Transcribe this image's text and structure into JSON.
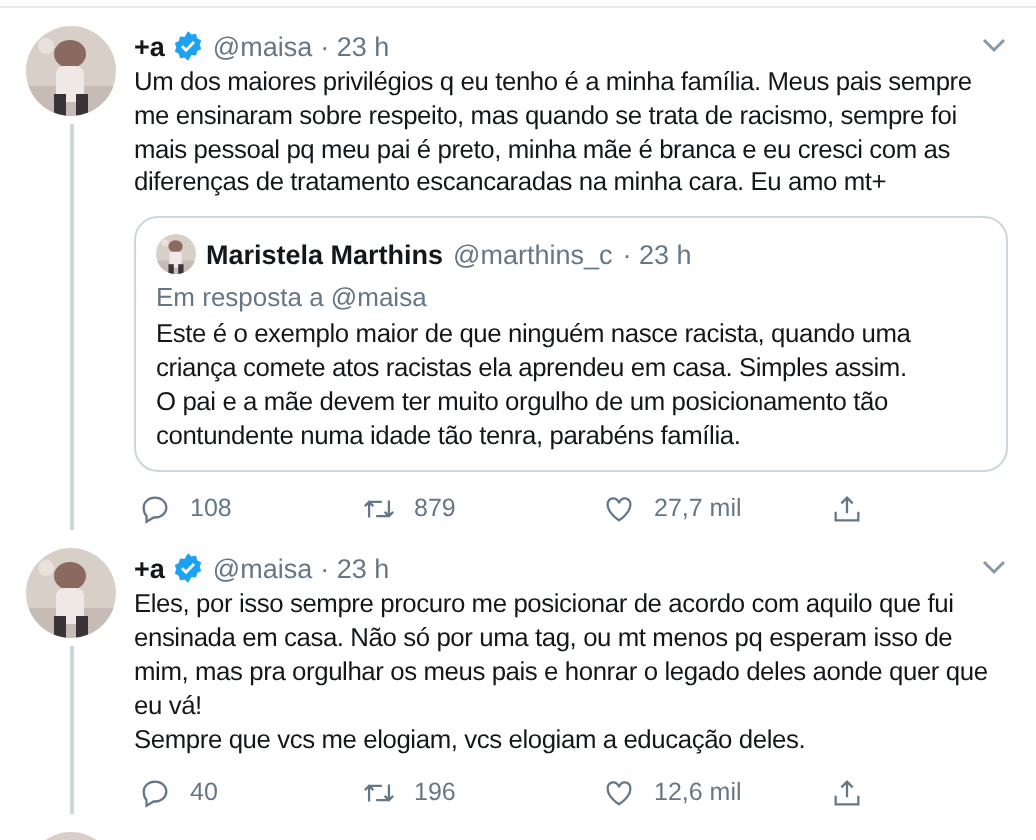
{
  "tweets": [
    {
      "name": "+a",
      "verified": true,
      "handle": "@maisa",
      "time": "· 23 h",
      "text": "Um dos maiores privilégios q eu tenho é a minha família. Meus pais sempre me ensinaram sobre respeito, mas quando se trata de racismo, sempre foi mais pessoal pq meu pai é preto, minha mãe é branca e eu cresci com as diferenças de tratamento escancaradas na minha cara. Eu amo mt+",
      "quote": {
        "name": "Maristela Marthins",
        "handle": "@marthins_c",
        "time": "· 23 h",
        "reply_to": "Em resposta a @maisa",
        "text": "Este é o exemplo maior de que ninguém nasce racista, quando uma criança comete atos racistas ela aprendeu em casa. Simples assim.\nO pai e a mãe devem ter muito orgulho de um posicionamento tão contundente numa idade tão tenra, parabéns família."
      },
      "replies": "108",
      "retweets": "879",
      "likes": "27,7 mil"
    },
    {
      "name": "+a",
      "verified": true,
      "handle": "@maisa",
      "time": "· 23 h",
      "text": "Eles, por isso sempre procuro me posicionar de acordo com aquilo que fui ensinada em casa. Não só por uma tag, ou mt menos pq esperam isso de mim, mas pra orgulhar os meus pais e honrar o legado deles aonde quer que eu vá!\nSempre que vcs me elogiam, vcs elogiam a educação deles.",
      "replies": "40",
      "retweets": "196",
      "likes": "12,6 mil"
    }
  ]
}
